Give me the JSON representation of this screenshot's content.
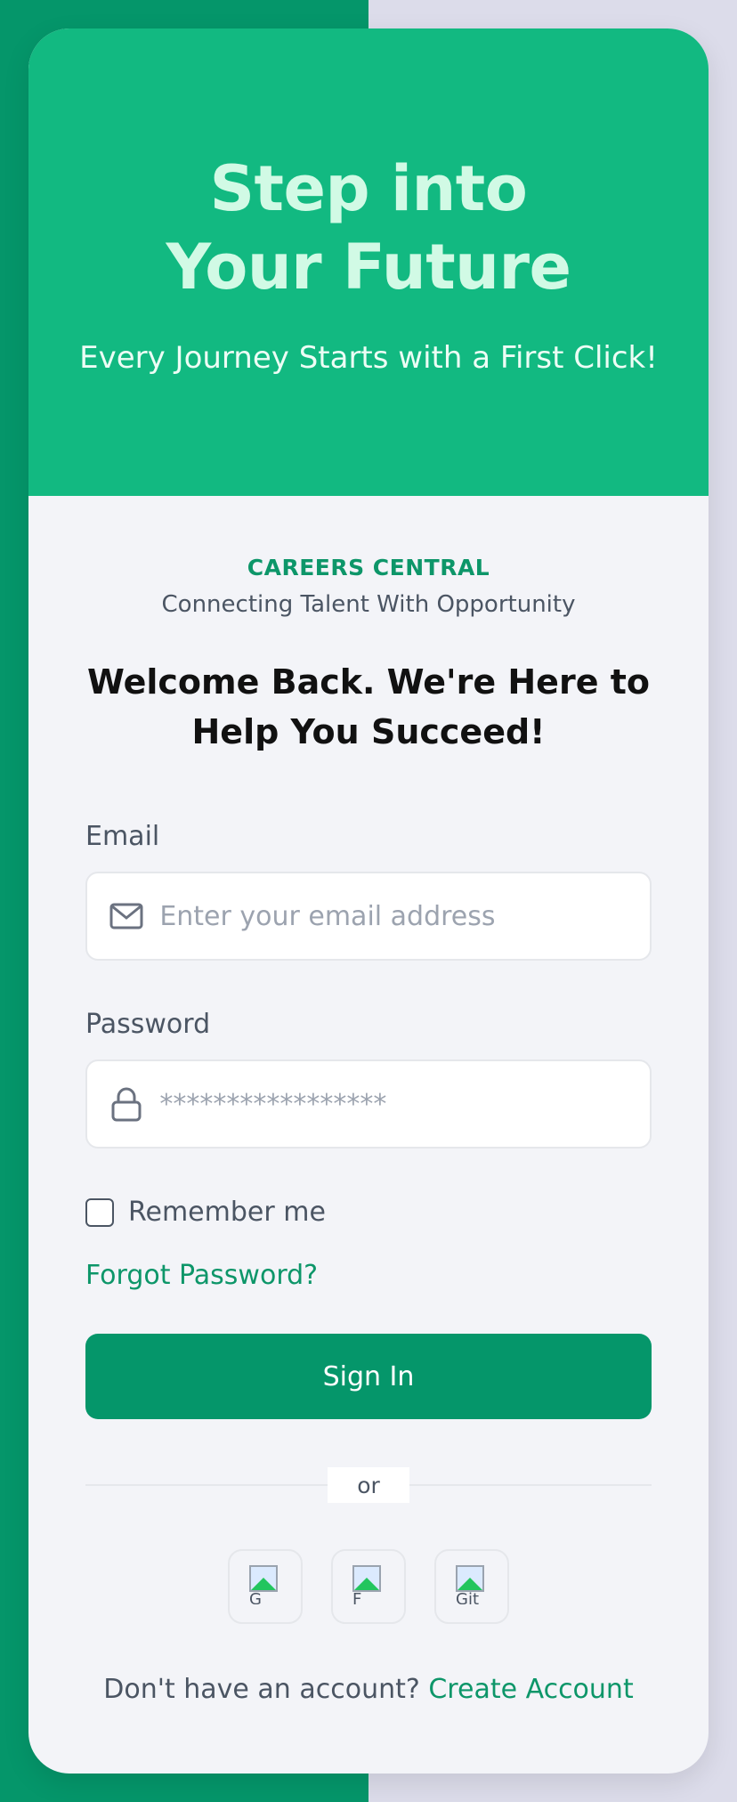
{
  "hero": {
    "title_line1": "Step into",
    "title_line2": "Your Future",
    "subtitle": "Every Journey Starts with a First Click!"
  },
  "brand": {
    "name": "CAREERS CENTRAL",
    "tagline": "Connecting Talent With Opportunity"
  },
  "welcome": "Welcome Back. We're Here to Help You Succeed!",
  "form": {
    "email_label": "Email",
    "email_placeholder": "Enter your email address",
    "email_icon": "mail-icon",
    "password_label": "Password",
    "password_placeholder": "*****************",
    "password_icon": "lock-icon",
    "remember_label": "Remember me",
    "forgot_label": "Forgot Password?",
    "submit_label": "Sign In"
  },
  "divider_text": "or",
  "social": [
    {
      "alt": "G"
    },
    {
      "alt": "F"
    },
    {
      "alt": "Git"
    }
  ],
  "footer": {
    "prompt": "Don't have an account?",
    "link_label": "Create Account"
  },
  "colors": {
    "primary": "#05966a",
    "hero_bg": "#12b981",
    "accent_text": "#0d9669"
  }
}
